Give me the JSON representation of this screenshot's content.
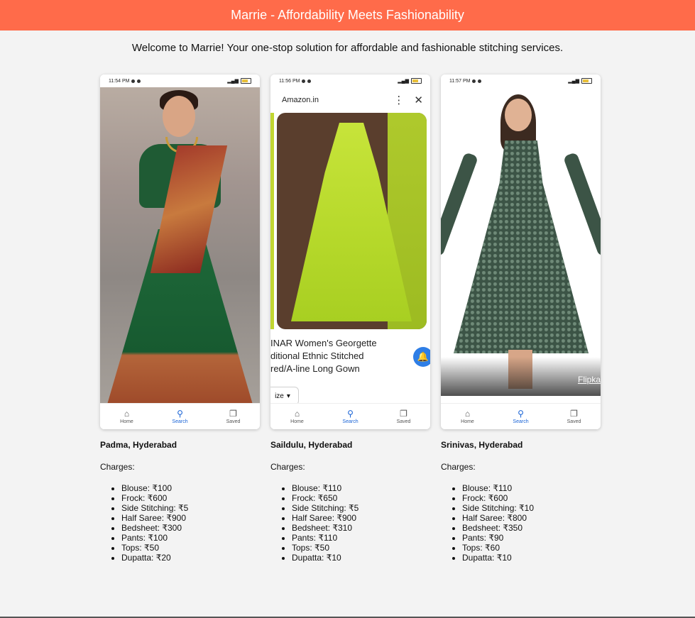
{
  "header": {
    "title": "Marrie - Affordability Meets Fashionability",
    "bg_color": "#ff6b4a"
  },
  "intro": {
    "text": "Welcome to Marrie! Your one-stop solution for affordable and fashionable stitching services."
  },
  "charges_label": "Charges:",
  "cards": [
    {
      "status_time": "11:54 PM",
      "artisan": "Padma, Hyderabad",
      "nav": [
        {
          "label": "Home",
          "icon": "home-icon"
        },
        {
          "label": "Search",
          "icon": "search-icon",
          "active": true
        },
        {
          "label": "Saved",
          "icon": "bookmark-icon"
        }
      ],
      "charges": [
        "Blouse: ₹100",
        "Frock: ₹600",
        "Side Stitching: ₹5",
        "Half Saree: ₹900",
        "Bedsheet: ₹300",
        "Pants: ₹100",
        "Tops: ₹50",
        "Dupatta: ₹20"
      ]
    },
    {
      "status_time": "11:56 PM",
      "browser_site": "Amazon.in",
      "product_title": "INAR Women's Georgette\nditional Ethnic Stitched\nred/A-line Long Gown",
      "size_chip": "ize",
      "artisan": "Saildulu, Hyderabad",
      "nav": [
        {
          "label": "Home",
          "icon": "home-icon"
        },
        {
          "label": "Search",
          "icon": "search-icon",
          "active": true
        },
        {
          "label": "Saved",
          "icon": "bookmark-icon"
        }
      ],
      "charges": [
        "Blouse: ₹110",
        "Frock: ₹650",
        "Side Stitching: ₹5",
        "Half Saree: ₹900",
        "Bedsheet: ₹310",
        "Pants: ₹110",
        "Tops: ₹50",
        "Dupatta: ₹10"
      ]
    },
    {
      "status_time": "11:57 PM",
      "brand_overlay": "Flipka",
      "artisan": "Srinivas, Hyderabad",
      "nav": [
        {
          "label": "Home",
          "icon": "home-icon"
        },
        {
          "label": "Search",
          "icon": "search-icon",
          "active": true
        },
        {
          "label": "Saved",
          "icon": "bookmark-icon"
        }
      ],
      "charges": [
        "Blouse: ₹110",
        "Frock: ₹600",
        "Side Stitching: ₹10",
        "Half Saree: ₹800",
        "Bedsheet: ₹350",
        "Pants: ₹90",
        "Tops: ₹60",
        "Dupatta: ₹10"
      ]
    }
  ]
}
